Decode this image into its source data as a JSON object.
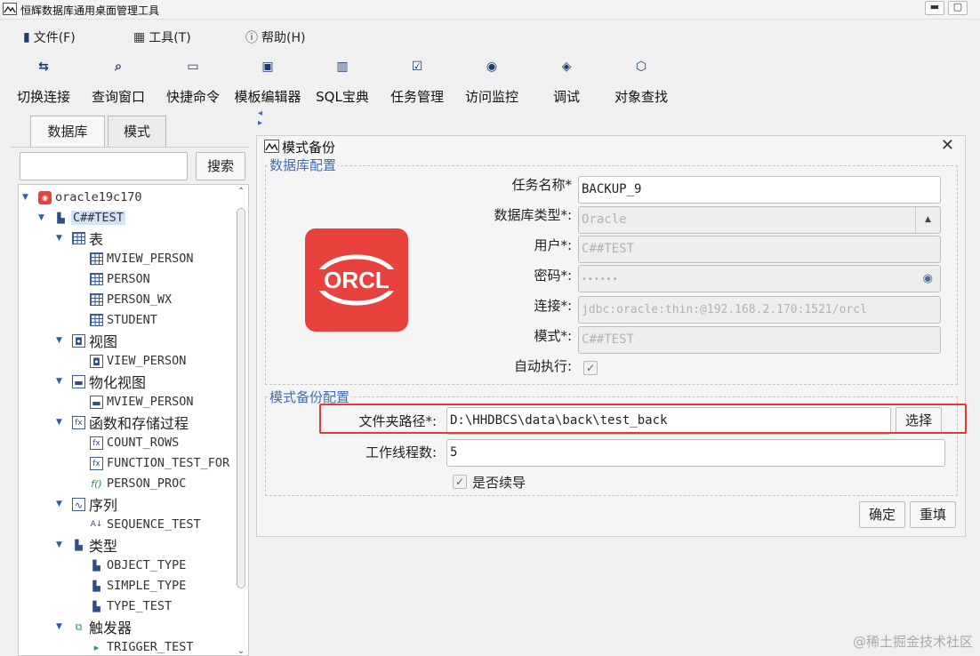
{
  "window": {
    "title": "恒辉数据库通用桌面管理工具",
    "minimize_label": "▬",
    "maximize_label": "▢"
  },
  "menubar": {
    "items": [
      {
        "label": "文件(F)",
        "icon": "file-icon"
      },
      {
        "label": "工具(T)",
        "icon": "tools-icon"
      },
      {
        "label": "帮助(H)",
        "icon": "help-icon"
      }
    ]
  },
  "toolbar": {
    "items": [
      {
        "label": "切换连接",
        "icon": "switch-connection-icon"
      },
      {
        "label": "查询窗口",
        "icon": "query-window-icon"
      },
      {
        "label": "快捷命令",
        "icon": "shortcut-command-icon"
      },
      {
        "label": "模板编辑器",
        "icon": "template-editor-icon"
      },
      {
        "label": "SQL宝典",
        "icon": "sql-book-icon"
      },
      {
        "label": "任务管理",
        "icon": "task-management-icon"
      },
      {
        "label": "访问监控",
        "icon": "access-monitor-icon"
      },
      {
        "label": "调试",
        "icon": "debug-icon"
      },
      {
        "label": "对象查找",
        "icon": "object-search-icon"
      }
    ]
  },
  "left_panel": {
    "tabs": [
      {
        "label": "数据库",
        "active": true
      },
      {
        "label": "模式",
        "active": false
      }
    ],
    "search": {
      "value": "",
      "button_label": "搜索"
    },
    "tree": [
      {
        "label": "oracle19c170",
        "icon": "oracle-connection-icon",
        "expanded": true
      },
      {
        "label": "C##TEST",
        "icon": "schema-icon",
        "expanded": true,
        "selected": true
      },
      {
        "label": "表",
        "icon": "table-icon",
        "expanded": true
      },
      {
        "label": "MVIEW_PERSON",
        "icon": "table-icon"
      },
      {
        "label": "PERSON",
        "icon": "table-icon"
      },
      {
        "label": "PERSON_WX",
        "icon": "table-icon"
      },
      {
        "label": "STUDENT",
        "icon": "table-icon"
      },
      {
        "label": "视图",
        "icon": "view-icon",
        "expanded": true
      },
      {
        "label": "VIEW_PERSON",
        "icon": "view-icon"
      },
      {
        "label": "物化视图",
        "icon": "materialized-view-icon",
        "expanded": true
      },
      {
        "label": "MVIEW_PERSON",
        "icon": "materialized-view-icon"
      },
      {
        "label": "函数和存储过程",
        "icon": "function-icon",
        "expanded": true
      },
      {
        "label": "COUNT_ROWS",
        "icon": "function-icon"
      },
      {
        "label": "FUNCTION_TEST_FOR",
        "icon": "function-icon"
      },
      {
        "label": "PERSON_PROC",
        "icon": "procedure-icon"
      },
      {
        "label": "序列",
        "icon": "sequence-icon",
        "expanded": true
      },
      {
        "label": "SEQUENCE_TEST",
        "icon": "sequence-item-icon"
      },
      {
        "label": "类型",
        "icon": "type-icon",
        "expanded": true
      },
      {
        "label": "OBJECT_TYPE",
        "icon": "type-icon"
      },
      {
        "label": "SIMPLE_TYPE",
        "icon": "type-icon"
      },
      {
        "label": "TYPE_TEST",
        "icon": "type-icon"
      },
      {
        "label": "触发器",
        "icon": "trigger-icon",
        "expanded": true
      },
      {
        "label": "TRIGGER_TEST",
        "icon": "trigger-item-icon"
      }
    ]
  },
  "dialog": {
    "title": "模式备份",
    "close_label": "✕",
    "db_config": {
      "legend": "数据库配置",
      "logo_text": "ORCL",
      "fields": [
        {
          "label": "任务名称*",
          "value": "BACKUP_9",
          "disabled": false
        },
        {
          "label": "数据库类型*:",
          "value": "Oracle",
          "disabled": true,
          "type": "select"
        },
        {
          "label": "用户*:",
          "value": "C##TEST",
          "disabled": true
        },
        {
          "label": "密码*:",
          "value": "••••••",
          "disabled": true,
          "type": "password"
        },
        {
          "label": "连接*:",
          "value": "jdbc:oracle:thin:@192.168.2.170:1521/orcl",
          "disabled": true
        },
        {
          "label": "模式*:",
          "value": "C##TEST",
          "disabled": true
        }
      ],
      "auto_execute": {
        "label": "自动执行:",
        "checked": true
      }
    },
    "backup_config": {
      "legend": "模式备份配置",
      "folder_path": {
        "label": "文件夹路径*:",
        "value": "D:\\HHDBCS\\data\\back\\test_back",
        "button_label": "选择"
      },
      "worker_threads": {
        "label": "工作线程数:",
        "value": "5"
      },
      "resume": {
        "label": "是否续导",
        "checked": true
      }
    },
    "buttons": {
      "confirm": "确定",
      "reset": "重填"
    }
  },
  "watermark": "@稀土掘金技术社区",
  "colors": {
    "accent": "#3f6fb0",
    "highlight": "#e53935",
    "logo": "#e8413e"
  }
}
